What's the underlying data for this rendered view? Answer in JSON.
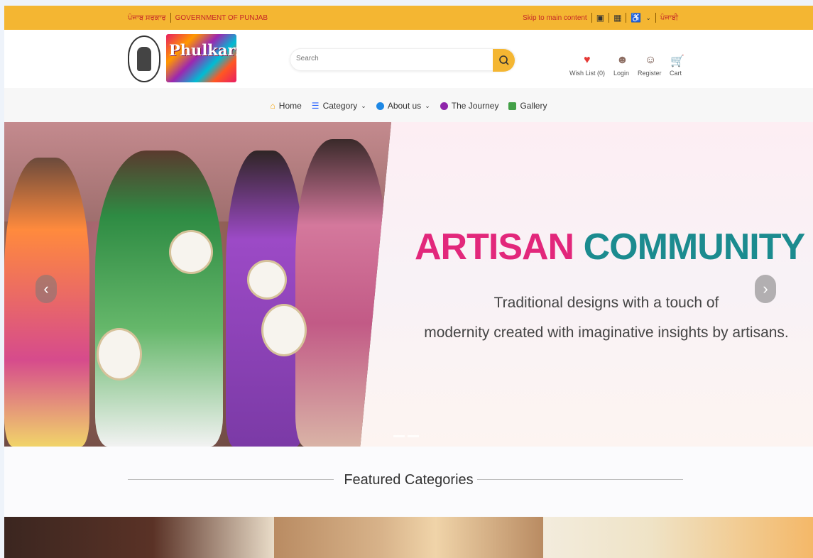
{
  "topbar": {
    "govt_punjabi": "ਪੰਜਾਬ ਸਰਕਾਰ",
    "govt_english": "GOVERNMENT OF PUNJAB",
    "skip_link": "Skip to main content",
    "language": "ਪੰਜਾਬੀ"
  },
  "header": {
    "logo_text": "Phulkari",
    "search": {
      "placeholder": "Search",
      "value": ""
    },
    "actions": {
      "wishlist": "Wish List (0)",
      "login": "Login",
      "register": "Register",
      "cart": "Cart"
    }
  },
  "nav": {
    "items": [
      {
        "label": "Home",
        "icon": "home-icon",
        "color": "#f4a100"
      },
      {
        "label": "Category",
        "icon": "menu-icon",
        "color": "#2962ff",
        "dropdown": true
      },
      {
        "label": "About us",
        "icon": "info-icon",
        "color": "#1e88e5",
        "dropdown": true
      },
      {
        "label": "The Journey",
        "icon": "location-icon",
        "color": "#8e24aa"
      },
      {
        "label": "Gallery",
        "icon": "gallery-icon",
        "color": "#43a047"
      }
    ]
  },
  "hero": {
    "headline_part1": "ARTISAN",
    "headline_part2": "COMMUNITY",
    "subtext_line1": "Traditional designs with a touch of",
    "subtext_line2": "modernity created with imaginative insights by artisans.",
    "colors": {
      "pink": "#e2277b",
      "teal": "#1b8b8f"
    }
  },
  "featured": {
    "title": "Featured Categories"
  },
  "colors": {
    "accent": "#f4b632",
    "topbar_text": "#c62828"
  }
}
